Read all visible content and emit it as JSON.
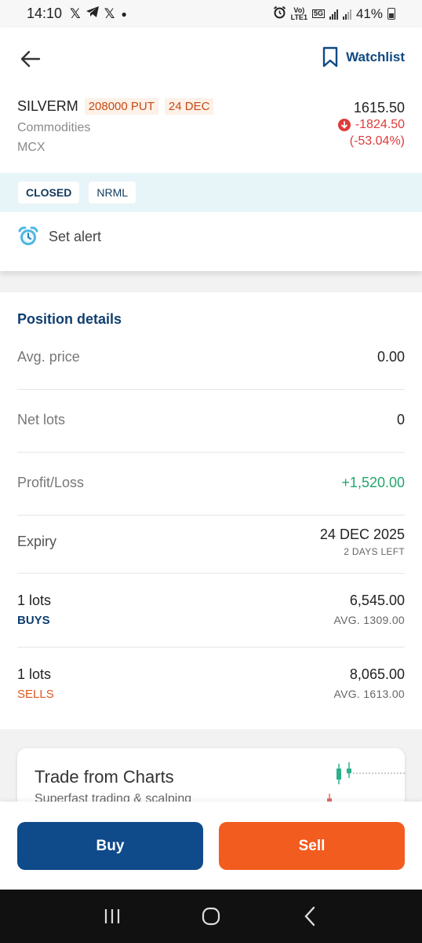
{
  "status_bar": {
    "time": "14:10",
    "notif_icons": [
      "x-icon",
      "telegram-icon",
      "x-icon"
    ],
    "network_label_top": "Vo)",
    "network_label_bottom": "LTE1",
    "net_type": "5G",
    "battery": "41%"
  },
  "header": {
    "watchlist_label": "Watchlist"
  },
  "instrument": {
    "symbol": "SILVERM",
    "strike_tag": "208000 PUT",
    "expiry_tag": "24 DEC",
    "segment": "Commodities",
    "exchange": "MCX",
    "ltp": "1615.50",
    "change": "-1824.50",
    "change_pct": "(-53.04%)"
  },
  "status_chips": [
    "CLOSED",
    "NRML"
  ],
  "alert": {
    "label": "Set alert"
  },
  "position": {
    "title": "Position details",
    "avg_price_label": "Avg. price",
    "avg_price_value": "0.00",
    "net_lots_label": "Net lots",
    "net_lots_value": "0",
    "pnl_label": "Profit/Loss",
    "pnl_value": "+1,520.00",
    "expiry_label": "Expiry",
    "expiry_date": "24 DEC 2025",
    "expiry_days_left": "2 DAYS LEFT",
    "buy": {
      "lots": "1 lots",
      "side": "BUYS",
      "amount": "6,545.00",
      "avg": "AVG. 1309.00"
    },
    "sell": {
      "lots": "1 lots",
      "side": "SELLS",
      "amount": "8,065.00",
      "avg": "AVG. 1613.00"
    }
  },
  "promo": {
    "title": "Trade from Charts",
    "subtitle": "Superfast trading & scalping"
  },
  "actions": {
    "buy_label": "Buy",
    "sell_label": "Sell"
  },
  "colors": {
    "brand_blue": "#0f4a8a",
    "sell_orange": "#f25c1f",
    "profit_green": "#22a56d",
    "loss_red": "#e03a3a",
    "strip_bg": "#e7f5f9"
  }
}
